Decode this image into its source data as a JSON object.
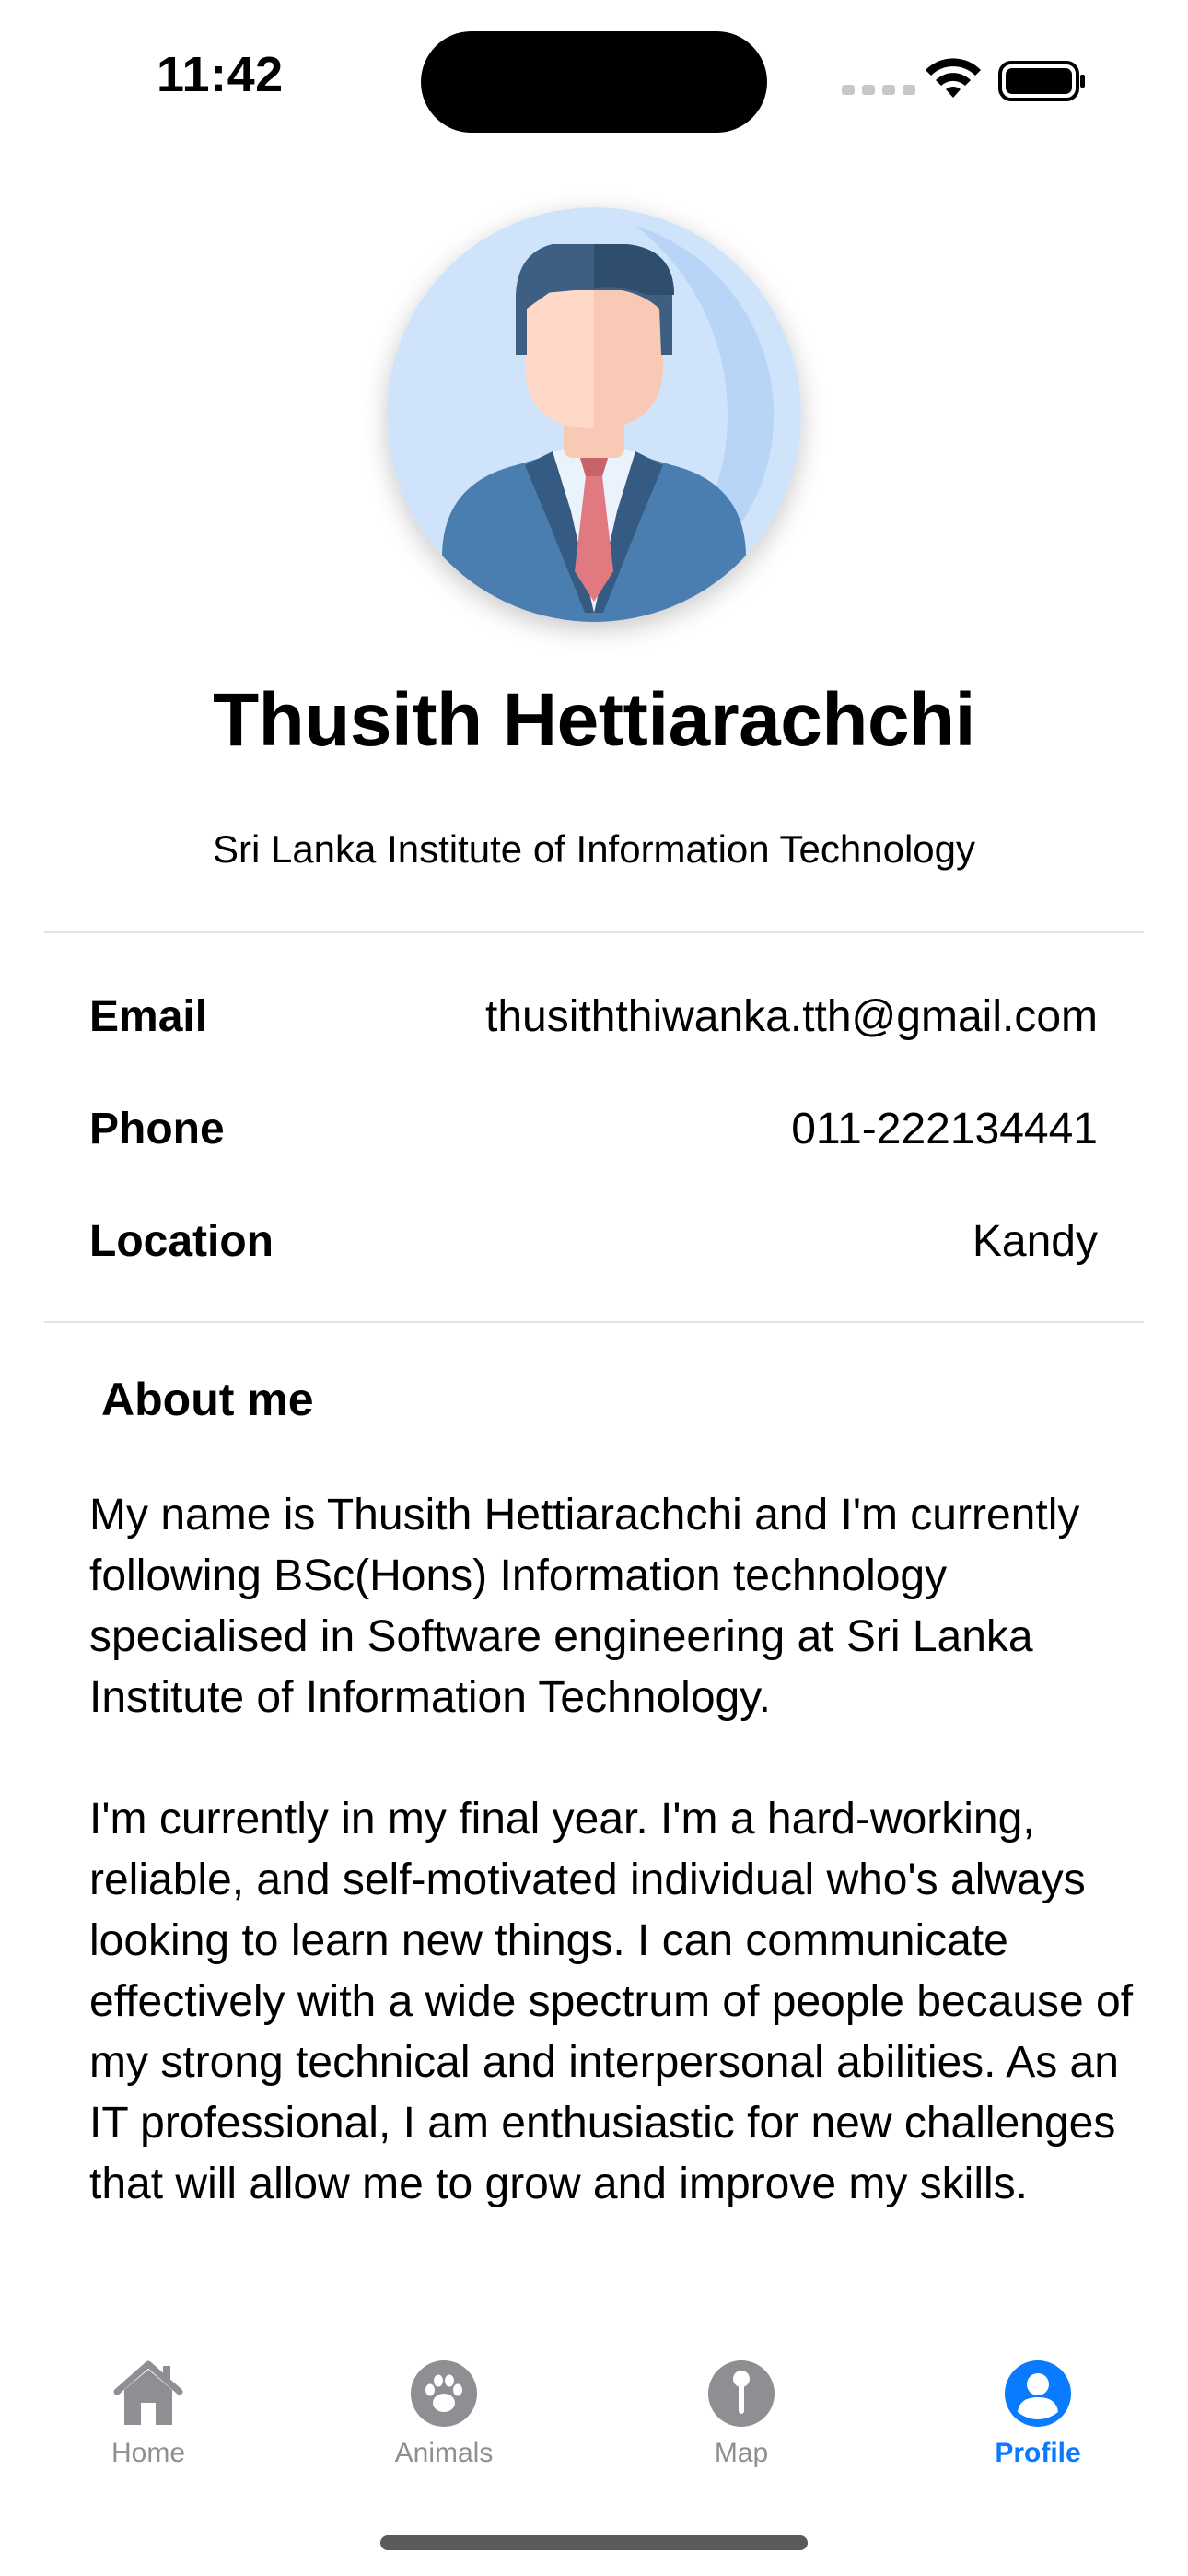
{
  "status_bar": {
    "time": "11:42"
  },
  "profile": {
    "name": "Thusith Hettiarachchi",
    "institute": "Sri Lanka Institute of Information Technology"
  },
  "info": {
    "email_label": "Email",
    "email_value": "thusiththiwanka.tth@gmail.com",
    "phone_label": "Phone",
    "phone_value": "011-222134441",
    "location_label": "Location",
    "location_value": "Kandy"
  },
  "about": {
    "title": "About me",
    "text": "My name is Thusith Hettiarachchi and I'm currently following BSc(Hons) Information technology specialised in Software engineering at Sri Lanka Institute of Information Technology.\n\nI'm currently in my final year. I'm a hard-working, reliable, and self-motivated individual who's always looking to learn new things. I can communicate effectively with a wide spectrum of people because of my strong technical and interpersonal abilities. As an IT professional, I am enthusiastic for new challenges that will allow me to grow and improve my skills."
  },
  "tabs": [
    {
      "label": "Home",
      "icon": "house-icon",
      "active": false
    },
    {
      "label": "Animals",
      "icon": "paw-icon",
      "active": false
    },
    {
      "label": "Map",
      "icon": "map-pin-icon",
      "active": false
    },
    {
      "label": "Profile",
      "icon": "person-circle-icon",
      "active": true
    }
  ],
  "colors": {
    "accent": "#0a7aff",
    "inactive_tab": "#8e8e93",
    "avatar_bg": "#cfe3fb",
    "suit": "#4a7eb0",
    "hair": "#3d5f82",
    "tie": "#e07a80"
  }
}
